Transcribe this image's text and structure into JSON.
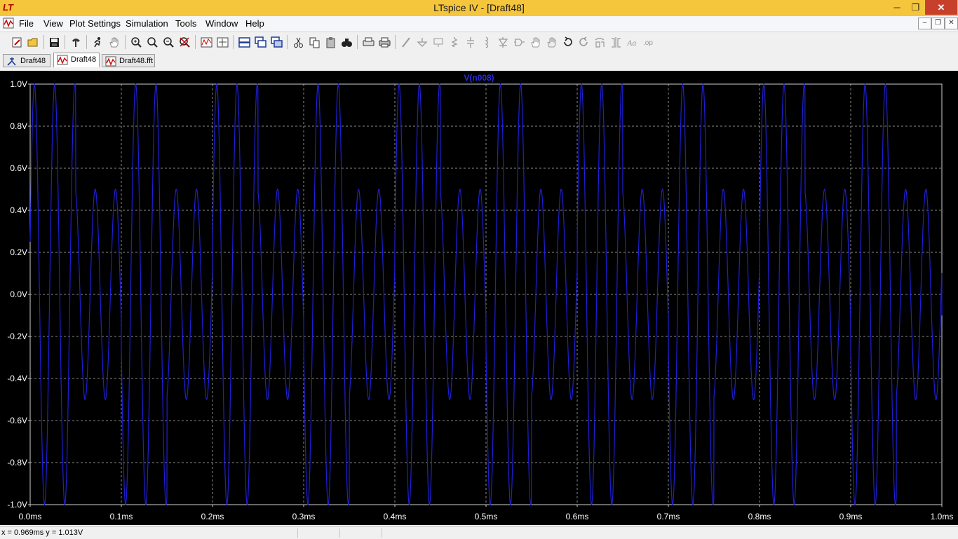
{
  "window": {
    "title": "LTspice IV - [Draft48]",
    "logo": "LT",
    "minimize_icon": "minimize-icon",
    "maximize_icon": "restore-icon",
    "close_icon": "close-icon",
    "min_glyph": "─",
    "max_glyph": "❐",
    "close_glyph": "✕"
  },
  "menu": {
    "items": [
      "File",
      "View",
      "Plot Settings",
      "Simulation",
      "Tools",
      "Window",
      "Help"
    ],
    "mdi_buttons": [
      "–",
      "❐",
      "✕"
    ]
  },
  "toolbar": {
    "icons": [
      "new-schematic-icon",
      "open-icon",
      "save-icon",
      "control-panel-icon",
      "run-icon",
      "pan-hand-icon",
      "zoom-in-icon",
      "zoom-area-icon",
      "zoom-out-icon",
      "zoom-cancel-icon",
      "autorange-icon",
      "fit-icon",
      "tile-horizontal-icon",
      "cascade-icon",
      "tile-vertical-icon",
      "cut-icon",
      "copy-icon",
      "paste-icon",
      "find-icon",
      "print-preview-icon",
      "print-icon",
      "wire-icon",
      "ground-icon",
      "label-icon",
      "resistor-icon",
      "capacitor-icon",
      "inductor-icon",
      "diode-icon",
      "component-icon",
      "move-icon",
      "drag-icon",
      "undo-icon",
      "redo-icon",
      "rotate-icon",
      "mirror-icon",
      "text-icon",
      "spice-directive-icon"
    ]
  },
  "tabs": [
    {
      "label": "Draft48",
      "icon": "schematic-icon",
      "active": false
    },
    {
      "label": "Draft48",
      "icon": "waveform-icon",
      "active": true
    },
    {
      "label": "Draft48.fft",
      "icon": "waveform-icon",
      "active": false
    }
  ],
  "colors": {
    "titlebar": "#f5c53c",
    "plot_bg": "#000000",
    "trace": "#1f1fd6",
    "grid": "#8a8a8a",
    "axis_text": "#ffffff",
    "trace_label": "#2a2adf"
  },
  "chart_data": {
    "type": "line",
    "title": "V(n008)",
    "xlabel": "",
    "ylabel": "",
    "x_unit": "ms",
    "y_unit": "V",
    "xlim": [
      0.0,
      1.0
    ],
    "ylim": [
      -1.0,
      1.0
    ],
    "x_ticks": [
      "0.0ms",
      "0.1ms",
      "0.2ms",
      "0.3ms",
      "0.4ms",
      "0.5ms",
      "0.6ms",
      "0.7ms",
      "0.8ms",
      "0.9ms",
      "1.0ms"
    ],
    "y_ticks": [
      "1.0V",
      "0.8V",
      "0.6V",
      "0.4V",
      "0.2V",
      "0.0V",
      "-0.2V",
      "-0.4V",
      "-0.6V",
      "-0.8V",
      "-1.0V"
    ],
    "grid": true,
    "series": [
      {
        "name": "V(n008)",
        "description": "ASK-modulated carrier",
        "carrier_frequency_khz": 45,
        "bit_period_ms": 0.05,
        "amplitudes": [
          1,
          0.5,
          1,
          0.5,
          1,
          0.5,
          1,
          0.5,
          1,
          0.5,
          1,
          0.5,
          1,
          0.5,
          1,
          0.5,
          1,
          0.5,
          1,
          0.5
        ],
        "start_value": 0.25,
        "end_value": -0.1
      }
    ]
  },
  "status": {
    "text": "x = 0.969ms   y = 1.013V"
  }
}
